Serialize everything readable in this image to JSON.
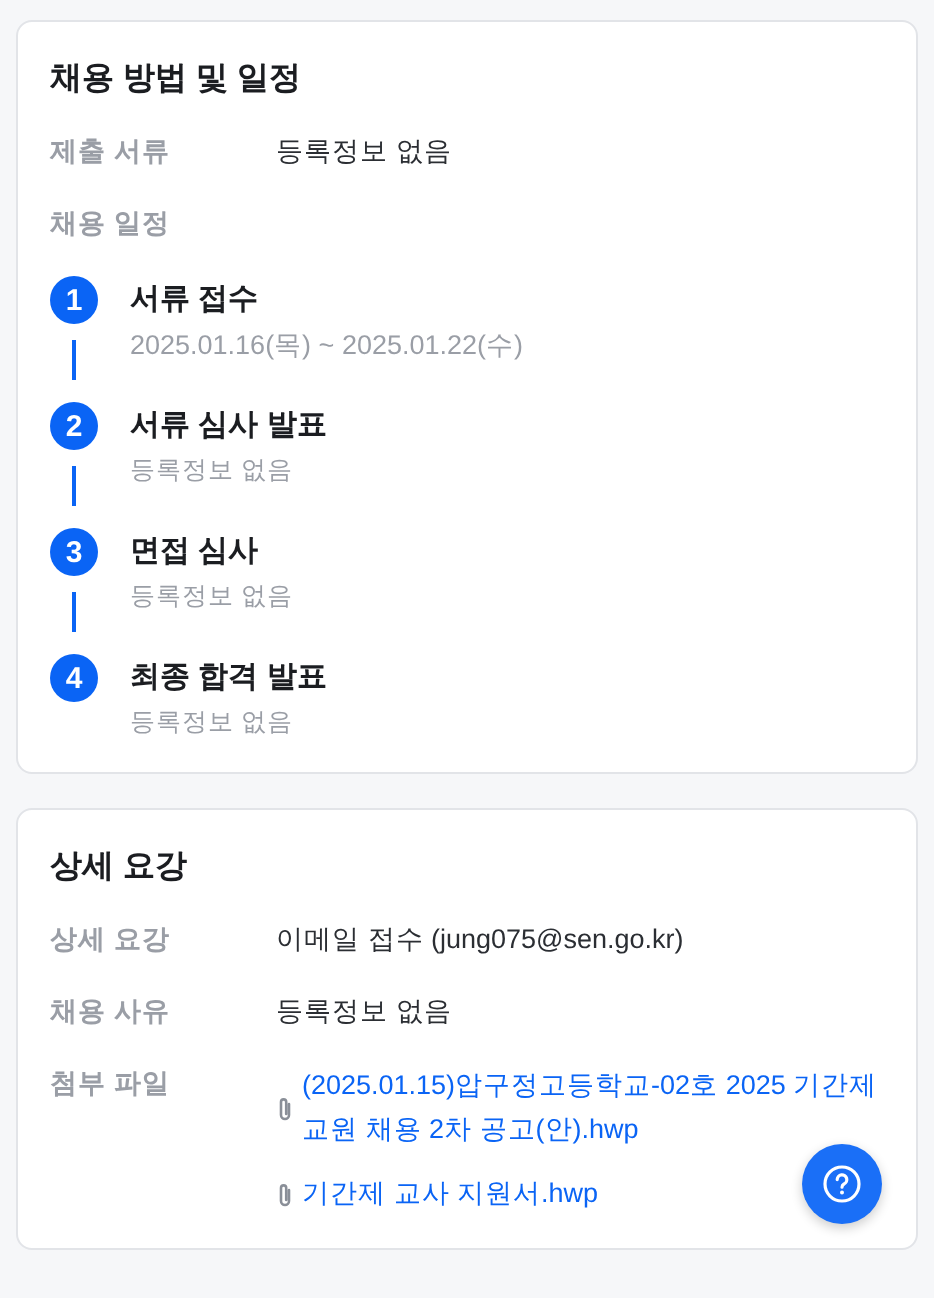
{
  "method_card": {
    "title": "채용 방법 및 일정",
    "documents": {
      "label": "제출 서류",
      "value": "등록정보 없음"
    },
    "schedule_label": "채용 일정",
    "steps": [
      {
        "number": "1",
        "title": "서류 접수",
        "detail": "2025.01.16(목) ~ 2025.01.22(수)"
      },
      {
        "number": "2",
        "title": "서류 심사 발표",
        "detail": "등록정보 없음"
      },
      {
        "number": "3",
        "title": "면접 심사",
        "detail": "등록정보 없음"
      },
      {
        "number": "4",
        "title": "최종 합격 발표",
        "detail": "등록정보 없음"
      }
    ]
  },
  "detail_card": {
    "title": "상세 요강",
    "rows": [
      {
        "label": "상세 요강",
        "value": "이메일 접수 (jung075@sen.go.kr)"
      },
      {
        "label": "채용 사유",
        "value": "등록정보 없음"
      }
    ],
    "attachments": {
      "label": "첨부 파일",
      "files": [
        "(2025.01.15)압구정고등학교-02호 2025 기간제교원 채용 2차 공고(안).hwp",
        "기간제 교사 지원서.hwp"
      ]
    }
  }
}
